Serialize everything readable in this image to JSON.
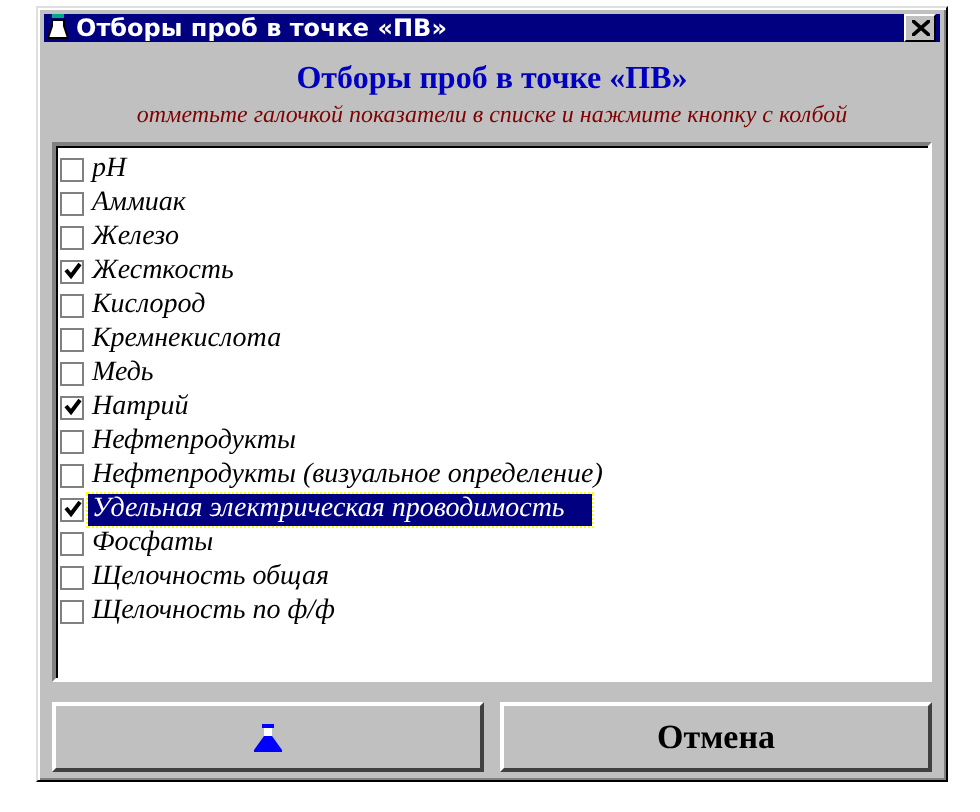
{
  "window": {
    "title": "Отборы проб в точке «ПВ»"
  },
  "heading": "Отборы проб в точке «ПВ»",
  "hint": "отметьте галочкой показатели в списке и нажмите кнопку с колбой",
  "items": [
    {
      "label": "pH",
      "checked": false,
      "selected": false
    },
    {
      "label": "Аммиак",
      "checked": false,
      "selected": false
    },
    {
      "label": "Железо",
      "checked": false,
      "selected": false
    },
    {
      "label": "Жесткость",
      "checked": true,
      "selected": false
    },
    {
      "label": "Кислород",
      "checked": false,
      "selected": false
    },
    {
      "label": "Кремнекислота",
      "checked": false,
      "selected": false
    },
    {
      "label": "Медь",
      "checked": false,
      "selected": false
    },
    {
      "label": "Натрий",
      "checked": true,
      "selected": false
    },
    {
      "label": "Нефтепродукты",
      "checked": false,
      "selected": false
    },
    {
      "label": "Нефтепродукты (визуальное определение)",
      "checked": false,
      "selected": false
    },
    {
      "label": "Удельная электрическая проводимость",
      "checked": true,
      "selected": true
    },
    {
      "label": "Фосфаты",
      "checked": false,
      "selected": false
    },
    {
      "label": "Щелочность общая",
      "checked": false,
      "selected": false
    },
    {
      "label": "Щелочность по ф/ф",
      "checked": false,
      "selected": false
    }
  ],
  "buttons": {
    "cancel": "Отмена"
  }
}
